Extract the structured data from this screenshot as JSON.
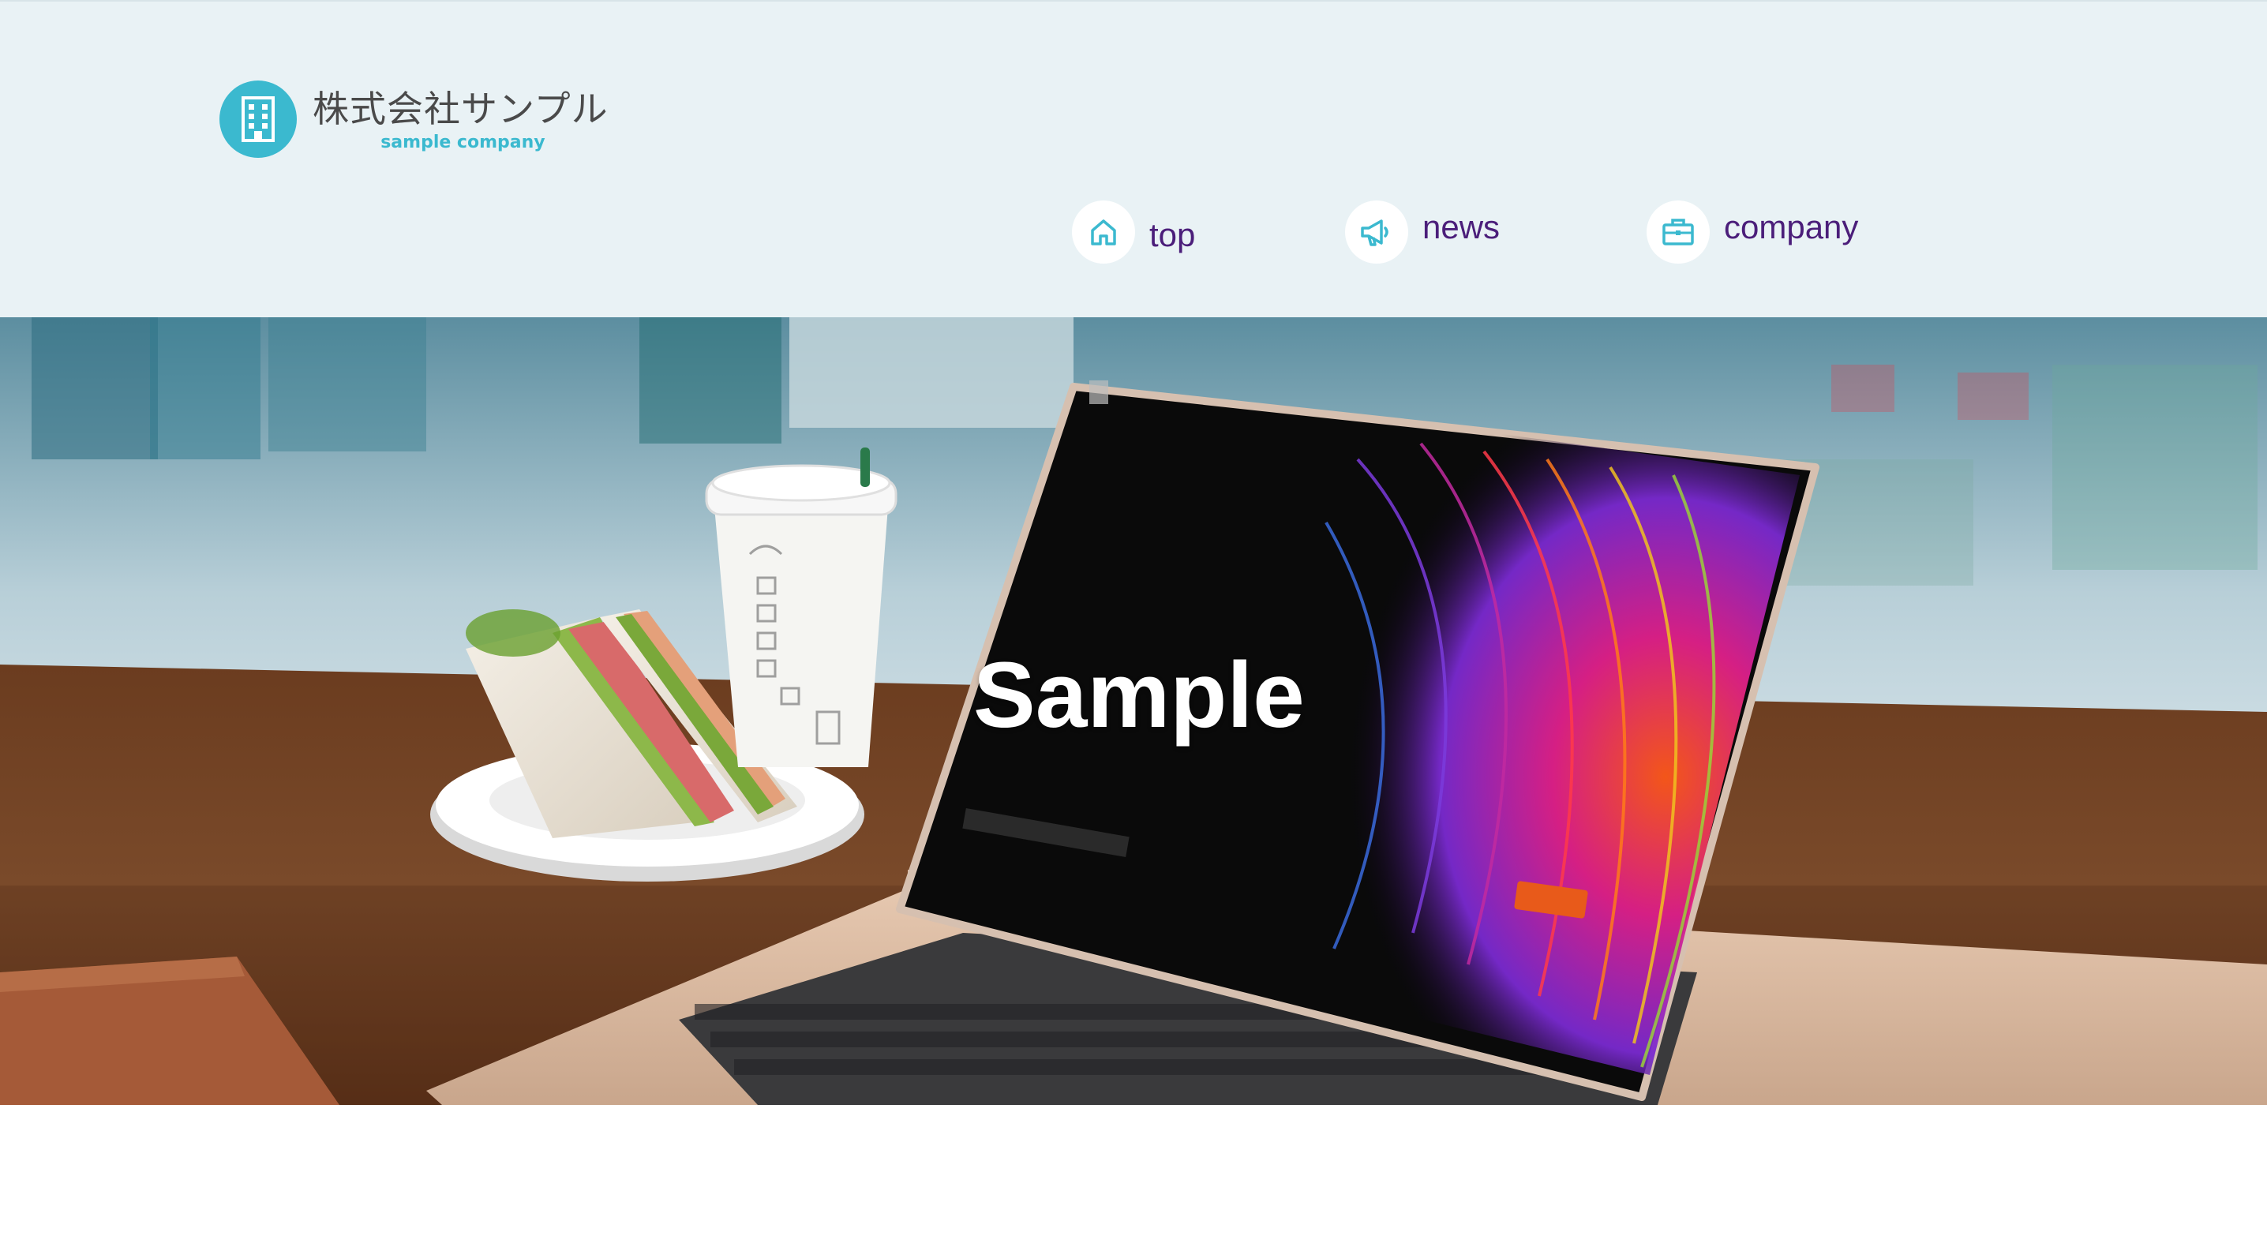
{
  "header": {
    "logo": {
      "name_jp": "株式会社サンプル",
      "name_en": "sample company",
      "icon": "building-icon"
    },
    "nav": [
      {
        "label": "top",
        "icon": "home-icon"
      },
      {
        "label": "news",
        "icon": "megaphone-icon"
      },
      {
        "label": "company",
        "icon": "briefcase-icon"
      }
    ]
  },
  "hero": {
    "title": "Sample"
  },
  "colors": {
    "header_bg": "#e9f2f5",
    "accent": "#3bb9cf",
    "nav_text": "#4b1e7a"
  }
}
